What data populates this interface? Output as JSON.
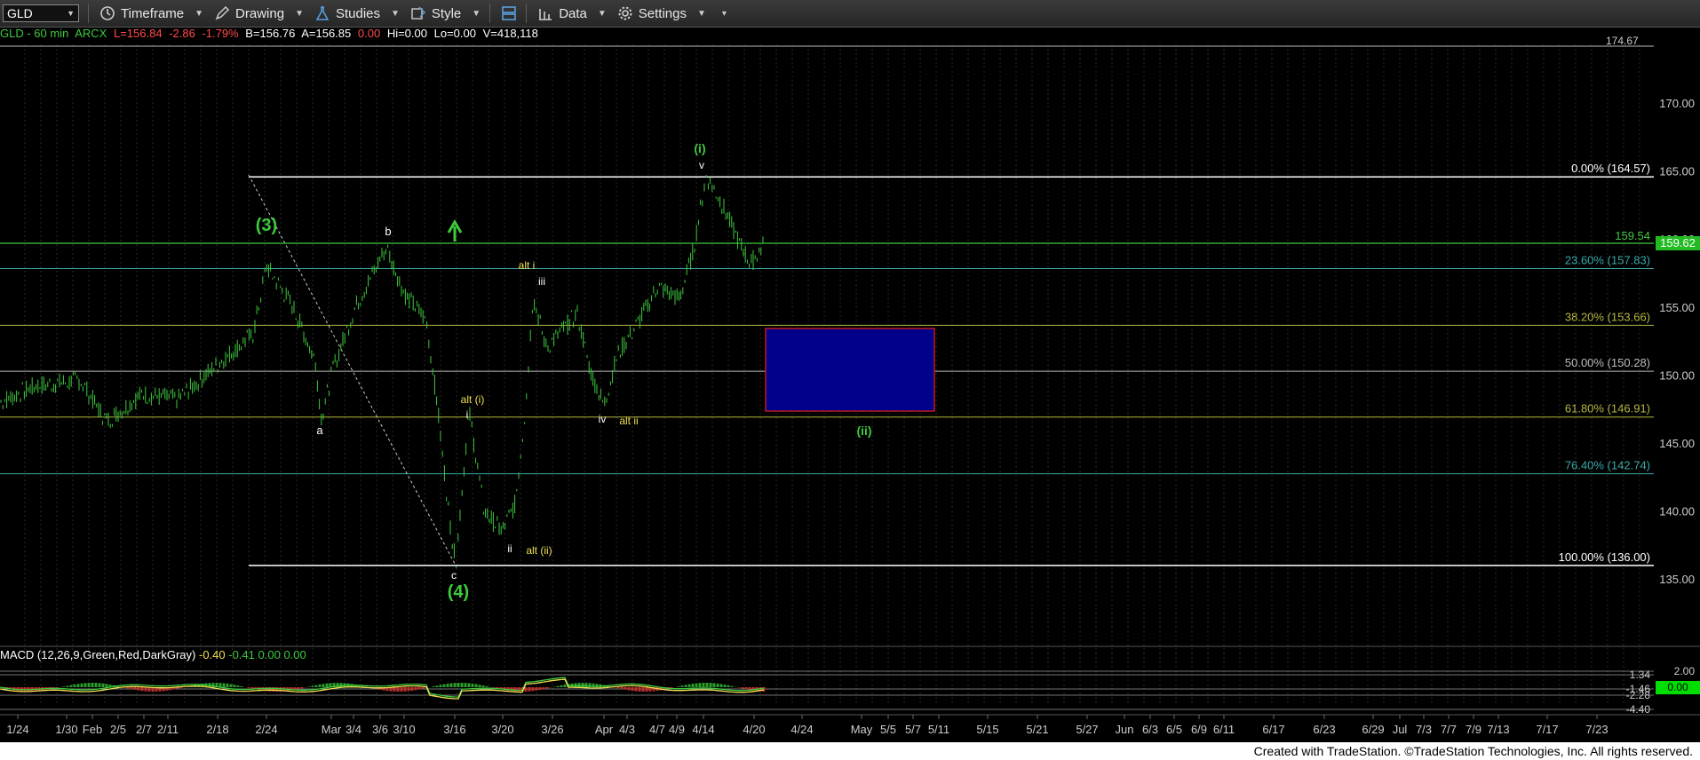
{
  "toolbar": {
    "symbol": "GLD",
    "timeframe": "Timeframe",
    "drawing": "Drawing",
    "studies": "Studies",
    "style": "Style",
    "data": "Data",
    "settings": "Settings"
  },
  "info": {
    "name": "GLD - 60 min",
    "exchange": "ARCX",
    "last": "L=156.84",
    "change": "-2.86",
    "pct": "-1.79%",
    "bid": "B=156.76",
    "ask": "A=156.85",
    "zero": "0.00",
    "hi": "Hi=0.00",
    "lo": "Lo=0.00",
    "vol": "V=418,118"
  },
  "price_axis": {
    "ticks": [
      "170.00",
      "165.00",
      "160.00",
      "155.00",
      "150.00",
      "145.00",
      "140.00",
      "135.00"
    ],
    "top_label": "174.67",
    "last_label": "159.62",
    "green_line_label": "159.54"
  },
  "fib_levels": [
    {
      "label": "0.00% (164.57)",
      "price": 164.57,
      "color": "#ffffff"
    },
    {
      "label": "23.60% (157.83)",
      "price": 157.83,
      "color": "#3aa7a7"
    },
    {
      "label": "38.20% (153.66)",
      "price": 153.66,
      "color": "#b5b540"
    },
    {
      "label": "50.00% (150.28)",
      "price": 150.28,
      "color": "#bbbbbb"
    },
    {
      "label": "61.80% (146.91)",
      "price": 146.91,
      "color": "#b5b540"
    },
    {
      "label": "76.40% (142.74)",
      "price": 142.74,
      "color": "#3aa7a7"
    },
    {
      "label": "100.00% (136.00)",
      "price": 136.0,
      "color": "#ffffff"
    }
  ],
  "wave_labels": [
    {
      "text": "(3)",
      "color": "#3ec93e"
    },
    {
      "text": "b",
      "color": "#ffffff"
    },
    {
      "text": "a",
      "color": "#ffffff"
    },
    {
      "text": "c",
      "color": "#ffffff"
    },
    {
      "text": "(4)",
      "color": "#3ec93e"
    },
    {
      "text": "alt i",
      "color": "#f0e050"
    },
    {
      "text": "iii",
      "color": "#ffffff"
    },
    {
      "text": "alt (i)",
      "color": "#f0e050"
    },
    {
      "text": "i",
      "color": "#ffffff"
    },
    {
      "text": "ii",
      "color": "#ffffff"
    },
    {
      "text": "alt (ii)",
      "color": "#f0e050"
    },
    {
      "text": "iv",
      "color": "#ffffff"
    },
    {
      "text": "alt ii",
      "color": "#f0e050"
    },
    {
      "text": "(i)",
      "color": "#3ec93e"
    },
    {
      "text": "v",
      "color": "#ffffff"
    },
    {
      "text": "(ii)",
      "color": "#3ec93e"
    }
  ],
  "target_box": {
    "top_price": 153.2,
    "bottom_price": 147.2,
    "color": "#00008b"
  },
  "x_axis_labels": [
    "1/24",
    "1/30",
    "Feb",
    "2/5",
    "2/7",
    "2/11",
    "2/18",
    "2/24",
    "Mar",
    "3/4",
    "3/6",
    "3/10",
    "3/16",
    "3/20",
    "3/26",
    "Apr",
    "4/3",
    "4/7",
    "4/9",
    "4/14",
    "4/20",
    "4/24",
    "May",
    "5/5",
    "5/7",
    "5/11",
    "5/15",
    "5/21",
    "5/27",
    "Jun",
    "6/3",
    "6/5",
    "6/9",
    "6/11",
    "6/17",
    "6/23",
    "6/29",
    "Jul",
    "7/3",
    "7/7",
    "7/9",
    "7/13",
    "7/17",
    "7/23"
  ],
  "macd": {
    "title": "MACD (12,26,9,Green,Red,DarkGray)",
    "v1": "-0.40",
    "v2": "-0.41",
    "v3": "0.00",
    "v4": "0.00",
    "axis": [
      "2.00",
      "1.34",
      "-1.46",
      "-2.28",
      "-4.40"
    ],
    "last_label": "0.00"
  },
  "footer": "Created with TradeStation. ©TradeStation Technologies, Inc. All rights reserved.",
  "colors": {
    "up": "#3ec93e",
    "down": "#ff4a4a",
    "background": "#000000"
  }
}
